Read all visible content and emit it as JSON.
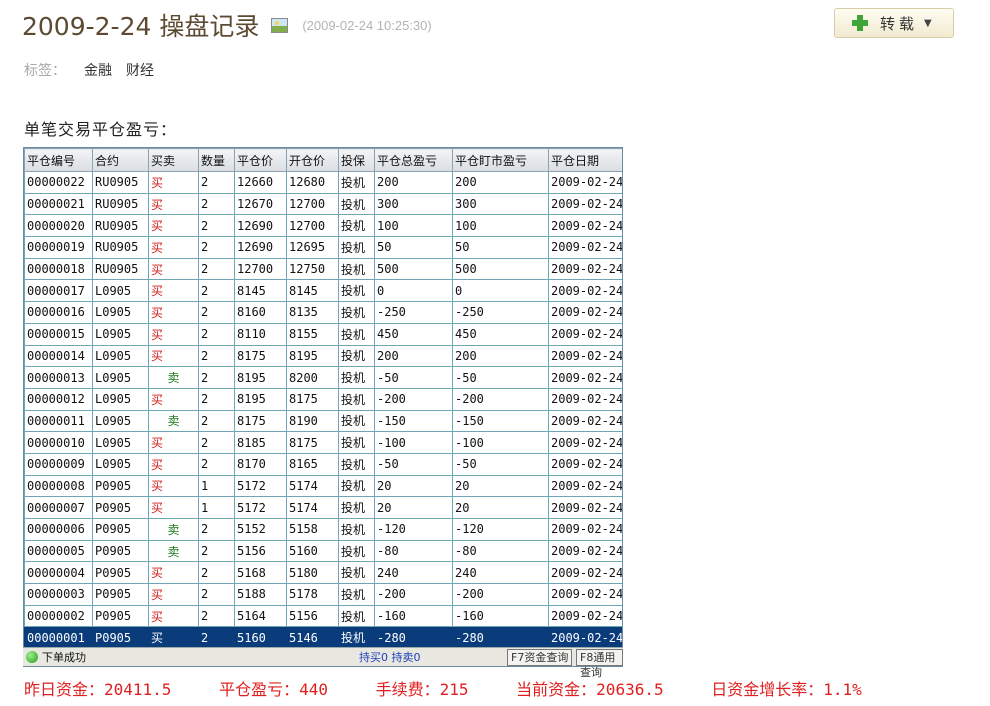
{
  "post": {
    "title": "2009-2-24 操盘记录",
    "timestamp": "(2009-02-24 10:25:30)",
    "repost_label": "转载",
    "tags_label": "标签：",
    "tags": [
      "金融",
      "财经"
    ],
    "intro": "单笔交易平仓盈亏："
  },
  "table": {
    "columns": [
      "平仓编号",
      "合约",
      "买卖",
      "数量",
      "平仓价",
      "开仓价",
      "投保",
      "平仓总盈亏",
      "平仓盯市盈亏",
      "平仓日期"
    ],
    "rows": [
      [
        "00000022",
        "RU0905",
        "买",
        "2",
        "12660",
        "12680",
        "投机",
        "200",
        "200",
        "2009-02-24"
      ],
      [
        "00000021",
        "RU0905",
        "买",
        "2",
        "12670",
        "12700",
        "投机",
        "300",
        "300",
        "2009-02-24"
      ],
      [
        "00000020",
        "RU0905",
        "买",
        "2",
        "12690",
        "12700",
        "投机",
        "100",
        "100",
        "2009-02-24"
      ],
      [
        "00000019",
        "RU0905",
        "买",
        "2",
        "12690",
        "12695",
        "投机",
        "50",
        "50",
        "2009-02-24"
      ],
      [
        "00000018",
        "RU0905",
        "买",
        "2",
        "12700",
        "12750",
        "投机",
        "500",
        "500",
        "2009-02-24"
      ],
      [
        "00000017",
        "L0905",
        "买",
        "2",
        "8145",
        "8145",
        "投机",
        "0",
        "0",
        "2009-02-24"
      ],
      [
        "00000016",
        "L0905",
        "买",
        "2",
        "8160",
        "8135",
        "投机",
        "-250",
        "-250",
        "2009-02-24"
      ],
      [
        "00000015",
        "L0905",
        "买",
        "2",
        "8110",
        "8155",
        "投机",
        "450",
        "450",
        "2009-02-24"
      ],
      [
        "00000014",
        "L0905",
        "买",
        "2",
        "8175",
        "8195",
        "投机",
        "200",
        "200",
        "2009-02-24"
      ],
      [
        "00000013",
        "L0905",
        "卖",
        "2",
        "8195",
        "8200",
        "投机",
        "-50",
        "-50",
        "2009-02-24"
      ],
      [
        "00000012",
        "L0905",
        "买",
        "2",
        "8195",
        "8175",
        "投机",
        "-200",
        "-200",
        "2009-02-24"
      ],
      [
        "00000011",
        "L0905",
        "卖",
        "2",
        "8175",
        "8190",
        "投机",
        "-150",
        "-150",
        "2009-02-24"
      ],
      [
        "00000010",
        "L0905",
        "买",
        "2",
        "8185",
        "8175",
        "投机",
        "-100",
        "-100",
        "2009-02-24"
      ],
      [
        "00000009",
        "L0905",
        "买",
        "2",
        "8170",
        "8165",
        "投机",
        "-50",
        "-50",
        "2009-02-24"
      ],
      [
        "00000008",
        "P0905",
        "买",
        "1",
        "5172",
        "5174",
        "投机",
        "20",
        "20",
        "2009-02-24"
      ],
      [
        "00000007",
        "P0905",
        "买",
        "1",
        "5172",
        "5174",
        "投机",
        "20",
        "20",
        "2009-02-24"
      ],
      [
        "00000006",
        "P0905",
        "卖",
        "2",
        "5152",
        "5158",
        "投机",
        "-120",
        "-120",
        "2009-02-24"
      ],
      [
        "00000005",
        "P0905",
        "卖",
        "2",
        "5156",
        "5160",
        "投机",
        "-80",
        "-80",
        "2009-02-24"
      ],
      [
        "00000004",
        "P0905",
        "买",
        "2",
        "5168",
        "5180",
        "投机",
        "240",
        "240",
        "2009-02-24"
      ],
      [
        "00000003",
        "P0905",
        "买",
        "2",
        "5188",
        "5178",
        "投机",
        "-200",
        "-200",
        "2009-02-24"
      ],
      [
        "00000002",
        "P0905",
        "买",
        "2",
        "5164",
        "5156",
        "投机",
        "-160",
        "-160",
        "2009-02-24"
      ],
      [
        "00000001",
        "P0905",
        "买",
        "2",
        "5160",
        "5146",
        "投机",
        "-280",
        "-280",
        "2009-02-24"
      ]
    ],
    "selected_row": 21,
    "status_message": "下单成功",
    "position_text": "持买0  持卖0",
    "f7_label": "F7资金查询",
    "f8_label": "F8通用查询"
  },
  "summary": {
    "prev_funds": "昨日资金：20411.5",
    "close_pnl": "平仓盈亏：440",
    "fees": "手续费：215",
    "current_funds": "当前资金：20636.5",
    "growth": "日资金增长率：1.1%"
  }
}
